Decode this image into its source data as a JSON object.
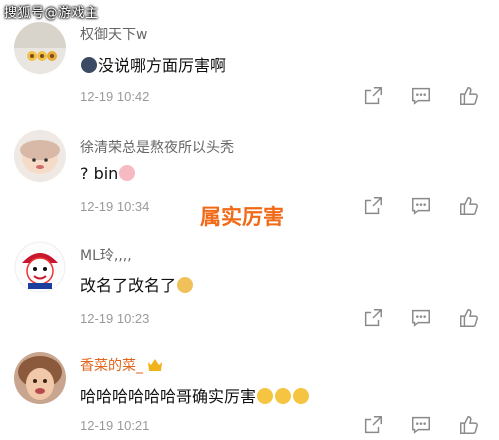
{
  "watermark": "搜狐号@游戏主",
  "overlay_caption": "属实厉害",
  "comments": [
    {
      "name": "权御天下w",
      "text": "没说哪方面厉害啊",
      "time": "12-19 10:42"
    },
    {
      "name": "徐清荣总是熬夜所以头秃",
      "text": "? bin",
      "time": "12-19 10:34"
    },
    {
      "name": "ML玲,,,,",
      "text": "改名了改名了",
      "time": "12-19 10:23"
    },
    {
      "name": "香菜的菜_",
      "text": "哈哈哈哈哈哈哥确实厉害",
      "time": "12-19 10:21"
    }
  ],
  "icons": {
    "share": "share-icon",
    "comment": "comment-icon",
    "like": "like-icon"
  },
  "colors": {
    "caption": "#f06a17",
    "vip_name": "#e0661b",
    "time": "#9a9a9a"
  }
}
